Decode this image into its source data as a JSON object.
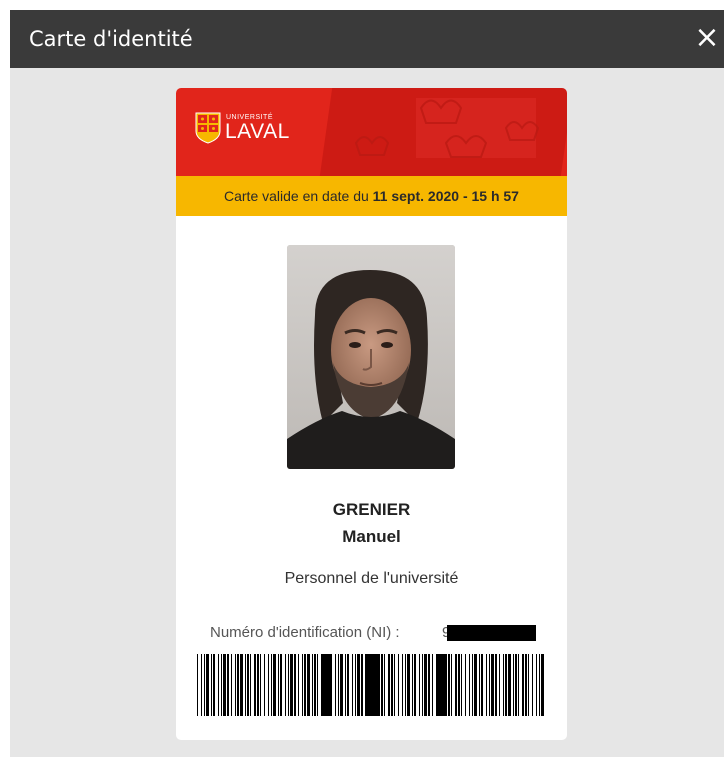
{
  "dialog": {
    "title": "Carte d'identité",
    "close_glyph": "×"
  },
  "card": {
    "logo": {
      "small_text": "UNIVERSITÉ",
      "big_text": "LAVAL"
    },
    "validity": {
      "prefix": "Carte valide en date du ",
      "datetime": "11 sept. 2020 - 15 h 57"
    },
    "last_name": "GRENIER",
    "first_name": "Manuel",
    "role": "Personnel de l'université",
    "ni_label": "Numéro d'identification (NI) :",
    "ni_visible_digit": "9"
  },
  "colors": {
    "titlebar": "#3a3a3a",
    "banner_red": "#e1251b",
    "validity_yellow": "#f7b700",
    "dialog_bg": "#e6e6e6"
  },
  "icons": {
    "close": "close-icon",
    "logo": "universite-laval-shield-icon"
  }
}
